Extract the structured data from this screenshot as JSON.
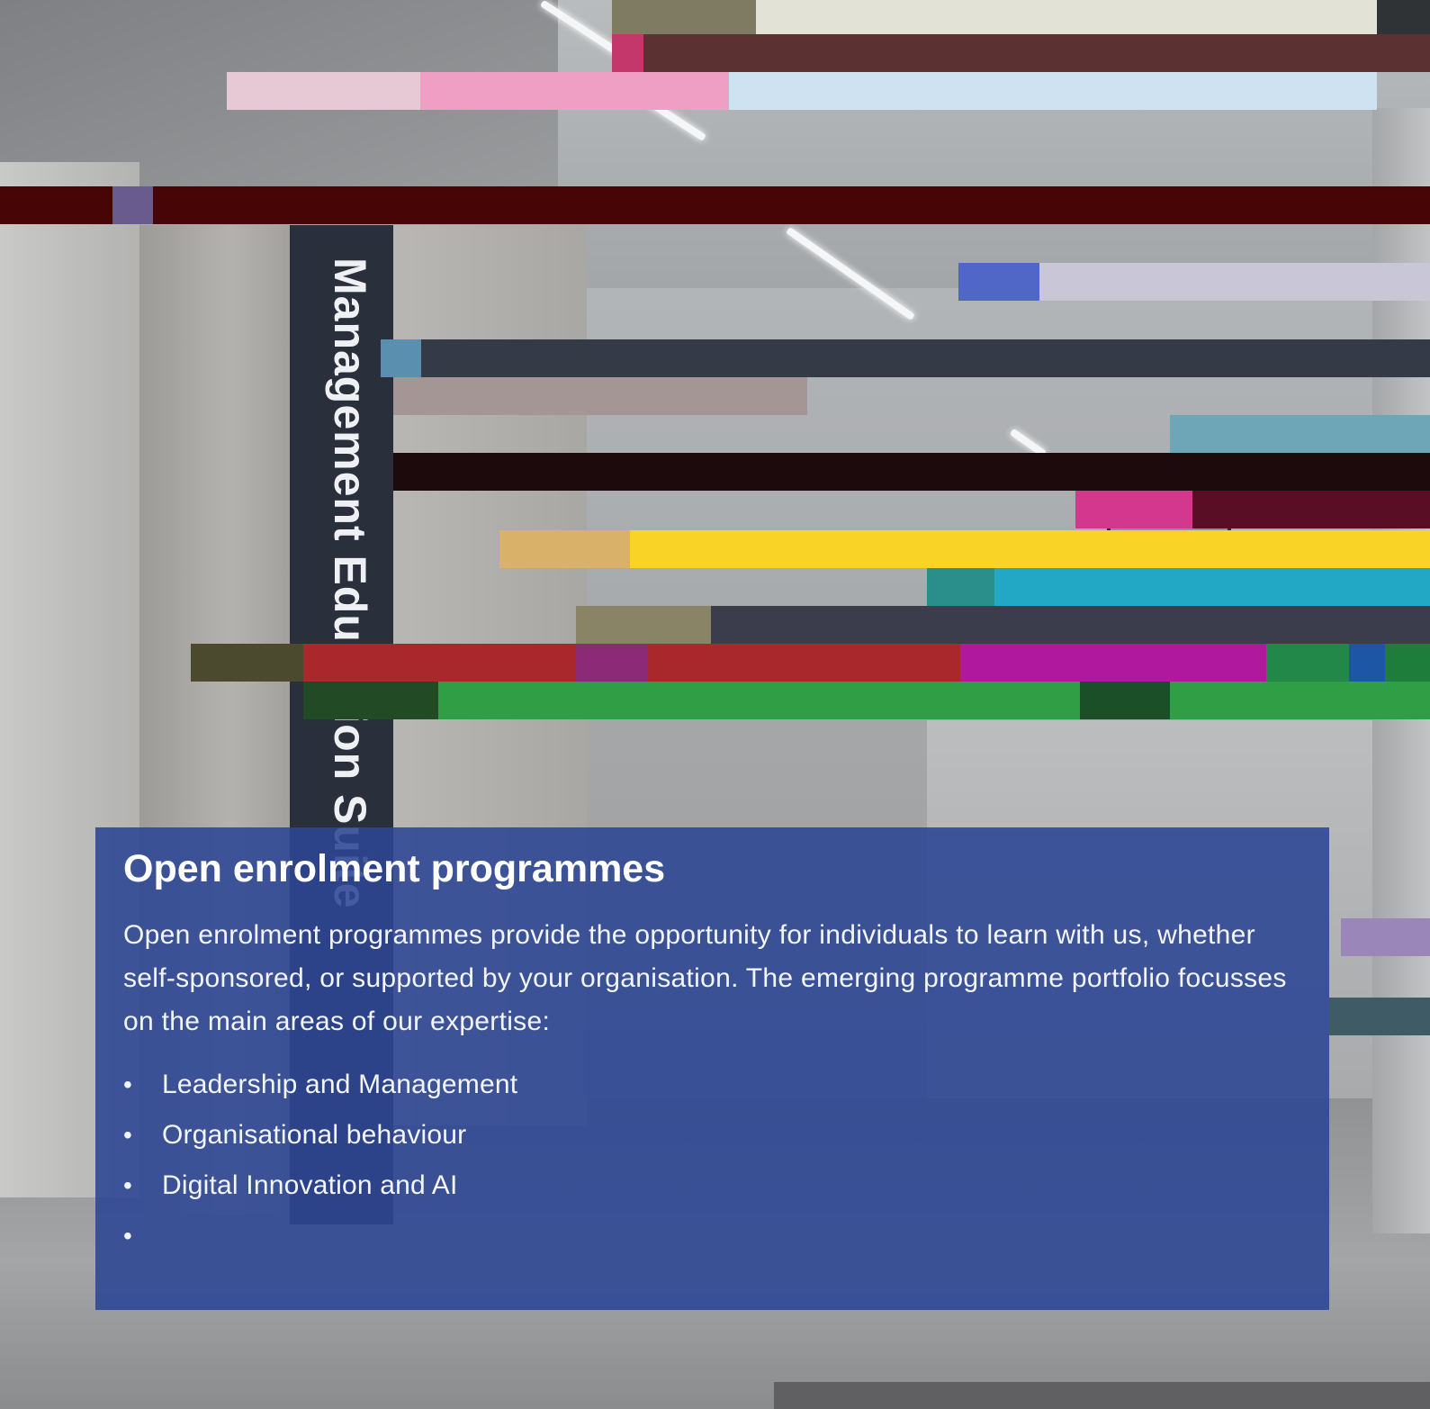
{
  "sign": {
    "text": "Management Education Suite"
  },
  "panel": {
    "title": "Open enrolment programmes",
    "body": "Open enrolment programmes provide the opportunity for individuals to learn with us, whether self-sponsored, or supported by your organisation. The emerging programme portfolio focusses on the main areas of our expertise:",
    "items": [
      "Leadership and Management",
      "Organisational behaviour",
      "Digital Innovation and AI",
      ""
    ]
  },
  "colors": {
    "panel_background": "#2c4594",
    "sign_background": "#2a2f3c",
    "glitch_yellow": "#f9d426",
    "glitch_cyan": "#22a8c4",
    "glitch_red": "#a8282c",
    "glitch_magenta": "#b0199d",
    "glitch_green": "#2f9e44",
    "glitch_pink": "#ef9fc4",
    "glitch_dark_red": "#470506"
  }
}
